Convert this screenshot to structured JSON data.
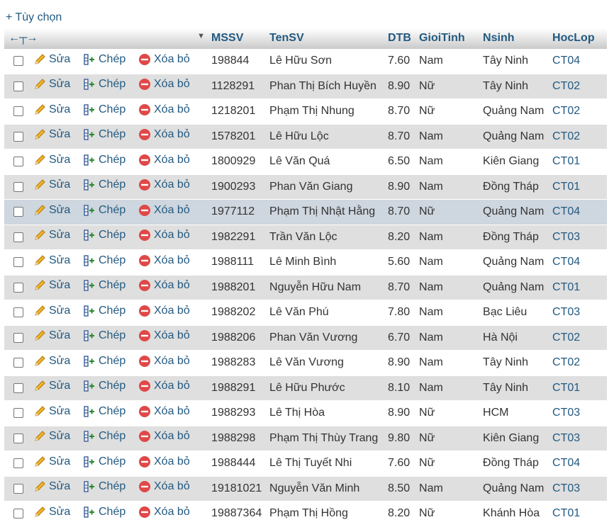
{
  "toolbar": {
    "options_label": "+ Tùy chọn"
  },
  "header": {
    "columns": [
      "MSSV",
      "TenSV",
      "DTB",
      "GioiTinh",
      "Nsinh",
      "HocLop"
    ]
  },
  "actions": {
    "edit": "Sửa",
    "copy": "Chép",
    "delete": "Xóa bỏ"
  },
  "rows": [
    {
      "mssv": "198844",
      "tensv": "Lê Hữu Sơn",
      "dtb": "7.60",
      "gioitinh": "Nam",
      "nsinh": "Tây Ninh",
      "hoclop": "CT04"
    },
    {
      "mssv": "1128291",
      "tensv": "Phan Thị Bích Huyền",
      "dtb": "8.90",
      "gioitinh": "Nữ",
      "nsinh": "Tây Ninh",
      "hoclop": "CT02"
    },
    {
      "mssv": "1218201",
      "tensv": "Phạm Thị Nhung",
      "dtb": "8.70",
      "gioitinh": "Nữ",
      "nsinh": "Quảng Nam",
      "hoclop": "CT02"
    },
    {
      "mssv": "1578201",
      "tensv": "Lê Hữu Lộc",
      "dtb": "8.70",
      "gioitinh": "Nam",
      "nsinh": "Quảng Nam",
      "hoclop": "CT02"
    },
    {
      "mssv": "1800929",
      "tensv": "Lê Văn Quá",
      "dtb": "6.50",
      "gioitinh": "Nam",
      "nsinh": "Kiên Giang",
      "hoclop": "CT01"
    },
    {
      "mssv": "1900293",
      "tensv": "Phan Văn Giang",
      "dtb": "8.90",
      "gioitinh": "Nam",
      "nsinh": "Đồng Tháp",
      "hoclop": "CT01"
    },
    {
      "mssv": "1977112",
      "tensv": "Phạm Thị Nhật Hằng",
      "dtb": "8.70",
      "gioitinh": "Nữ",
      "nsinh": "Quảng Nam",
      "hoclop": "CT04"
    },
    {
      "mssv": "1982291",
      "tensv": "Trần Văn Lộc",
      "dtb": "8.20",
      "gioitinh": "Nam",
      "nsinh": "Đồng Tháp",
      "hoclop": "CT03"
    },
    {
      "mssv": "1988111",
      "tensv": "Lê Minh Bình",
      "dtb": "5.60",
      "gioitinh": "Nam",
      "nsinh": "Quảng Nam",
      "hoclop": "CT04"
    },
    {
      "mssv": "1988201",
      "tensv": "Nguyễn Hữu Nam",
      "dtb": "8.70",
      "gioitinh": "Nam",
      "nsinh": "Quảng Nam",
      "hoclop": "CT01"
    },
    {
      "mssv": "1988202",
      "tensv": "Lê Văn Phú",
      "dtb": "7.80",
      "gioitinh": "Nam",
      "nsinh": "Bạc Liêu",
      "hoclop": "CT03"
    },
    {
      "mssv": "1988206",
      "tensv": "Phan Văn Vương",
      "dtb": "6.70",
      "gioitinh": "Nam",
      "nsinh": "Hà Nội",
      "hoclop": "CT02"
    },
    {
      "mssv": "1988283",
      "tensv": "Lê Văn Vương",
      "dtb": "8.90",
      "gioitinh": "Nam",
      "nsinh": "Tây Ninh",
      "hoclop": "CT02"
    },
    {
      "mssv": "1988291",
      "tensv": "Lê Hữu Phước",
      "dtb": "8.10",
      "gioitinh": "Nam",
      "nsinh": "Tây Ninh",
      "hoclop": "CT01"
    },
    {
      "mssv": "1988293",
      "tensv": "Lê Thị Hòa",
      "dtb": "8.90",
      "gioitinh": "Nữ",
      "nsinh": "HCM",
      "hoclop": "CT03"
    },
    {
      "mssv": "1988298",
      "tensv": "Phạm Thị Thùy Trang",
      "dtb": "9.80",
      "gioitinh": "Nữ",
      "nsinh": "Kiên Giang",
      "hoclop": "CT03"
    },
    {
      "mssv": "1988444",
      "tensv": "Lê Thị Tuyết Nhi",
      "dtb": "7.60",
      "gioitinh": "Nữ",
      "nsinh": "Đồng Tháp",
      "hoclop": "CT04"
    },
    {
      "mssv": "19181021",
      "tensv": "Nguyễn Văn Minh",
      "dtb": "8.50",
      "gioitinh": "Nam",
      "nsinh": "Quảng Nam",
      "hoclop": "CT03"
    },
    {
      "mssv": "19887364",
      "tensv": "Phạm Thị Hồng",
      "dtb": "8.20",
      "gioitinh": "Nữ",
      "nsinh": "Khánh Hòa",
      "hoclop": "CT01"
    }
  ],
  "highlighted_row": 7,
  "colors": {
    "link": "#235a81",
    "row_even": "#dfdfdf",
    "row_highlight": "#ced6df",
    "delete": "#e85a5a",
    "pencil": "#e8a020"
  }
}
